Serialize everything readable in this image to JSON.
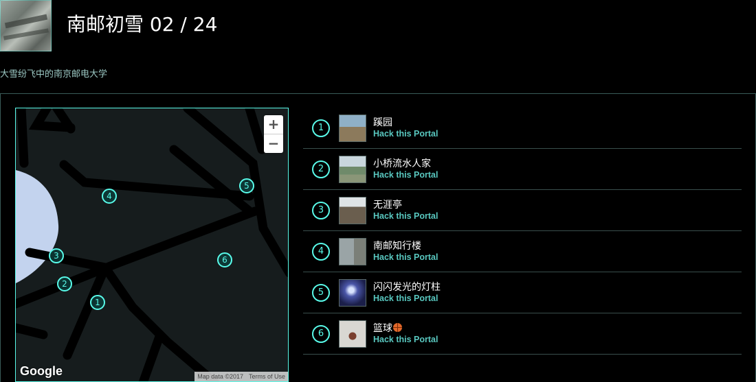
{
  "header": {
    "title": "南邮初雪 02 / 24",
    "description": "大雪纷飞中的南京邮电大学"
  },
  "map": {
    "zoom_in": "+",
    "zoom_out": "−",
    "logo": "Google",
    "attribution": "Map data ©2017",
    "terms": "Terms of Use",
    "markers": [
      "1",
      "2",
      "3",
      "4",
      "5",
      "6"
    ]
  },
  "portals": [
    {
      "num": "1",
      "name": "蹊园",
      "link": "Hack this Portal"
    },
    {
      "num": "2",
      "name": "小桥流水人家",
      "link": "Hack this Portal"
    },
    {
      "num": "3",
      "name": "无涯亭",
      "link": "Hack this Portal"
    },
    {
      "num": "4",
      "name": "南邮知行楼",
      "link": "Hack this Portal"
    },
    {
      "num": "5",
      "name": "闪闪发光的灯柱",
      "link": "Hack this Portal"
    },
    {
      "num": "6",
      "name": "篮球",
      "link": "Hack this Portal"
    }
  ],
  "colors": {
    "accent": "#59fbea",
    "link": "#59c8c0",
    "background": "#000000",
    "map_background": "#161c1d",
    "water": "#c3d3ee"
  }
}
